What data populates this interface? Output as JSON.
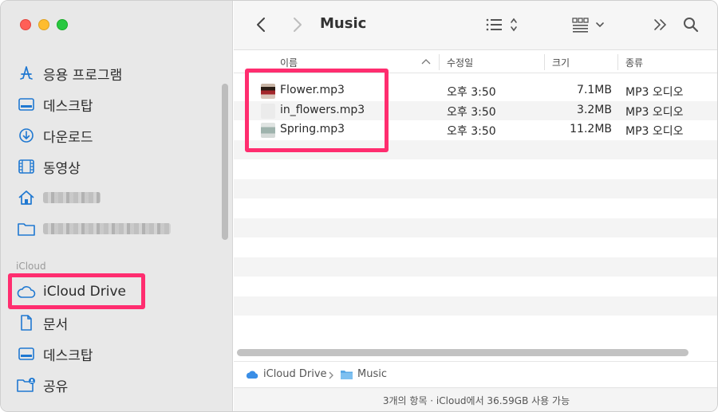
{
  "window": {
    "title": "Music"
  },
  "sidebar": {
    "favorites": [
      {
        "label": "응용 프로그램",
        "icon": "applications-icon"
      },
      {
        "label": "데스크탑",
        "icon": "desktop-icon"
      },
      {
        "label": "다운로드",
        "icon": "download-icon"
      },
      {
        "label": "동영상",
        "icon": "movies-icon"
      },
      {
        "label": "",
        "icon": "home-icon",
        "blurred": true
      },
      {
        "label": "",
        "icon": "folder-icon",
        "blurred": true
      }
    ],
    "section_icloud": "iCloud",
    "icloud": [
      {
        "label": "iCloud Drive",
        "icon": "icloud-icon"
      },
      {
        "label": "문서",
        "icon": "document-icon"
      },
      {
        "label": "데스크탑",
        "icon": "desktop-icon"
      },
      {
        "label": "공유",
        "icon": "shared-folder-icon"
      }
    ]
  },
  "toolbar": {
    "title": "Music"
  },
  "columns": {
    "name": "이름",
    "date": "수정일",
    "size": "크기",
    "kind": "종류"
  },
  "files": [
    {
      "name": "Flower.mp3",
      "date": "오후 3:50",
      "size": "7.1MB",
      "kind": "MP3 오디오"
    },
    {
      "name": "in_flowers.mp3",
      "date": "오후 3:50",
      "size": "3.2MB",
      "kind": "MP3 오디오"
    },
    {
      "name": "Spring.mp3",
      "date": "오후 3:50",
      "size": "11.2MB",
      "kind": "MP3 오디오"
    }
  ],
  "pathbar": {
    "root": "iCloud Drive",
    "folder": "Music"
  },
  "status": {
    "text": "3개의 항목 · iCloud에서 36.59GB 사용 가능"
  },
  "colors": {
    "accent": "#1f78d1",
    "highlight": "#ff2d6f"
  }
}
